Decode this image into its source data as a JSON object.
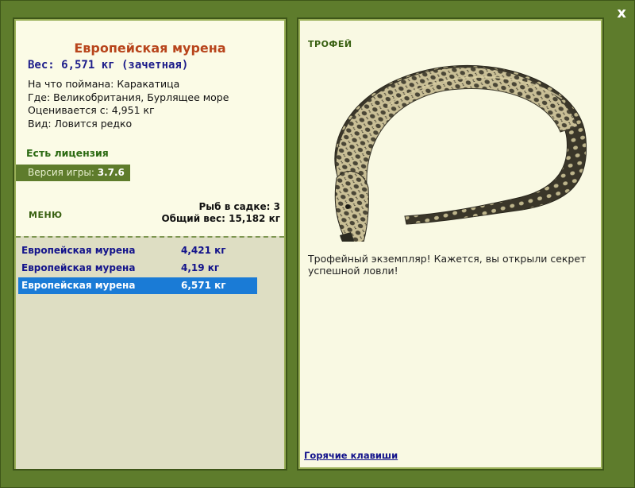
{
  "window": {
    "close_label": "x"
  },
  "fish": {
    "name": "Европейская мурена",
    "weight_line": "Вес: 6,571 кг (зачетная)",
    "info": [
      "На что поймана: Каракатица",
      "Где: Великобритания, Бурлящее море",
      "Оценивается с: 4,951 кг",
      "Вид: Ловится редко"
    ]
  },
  "license": "Есть лицензия",
  "version": {
    "label": "Версия игры:",
    "value": "3.7.6"
  },
  "menu_label": "МЕНЮ",
  "keepnet": {
    "count_line": "Рыб в садке: 3",
    "total_line": "Общий вес: 15,182 кг",
    "items": [
      {
        "name": "Европейская мурена",
        "weight": "4,421 кг",
        "selected": false
      },
      {
        "name": "Европейская мурена",
        "weight": "4,19 кг",
        "selected": false
      },
      {
        "name": "Европейская мурена",
        "weight": "6,571 кг",
        "selected": true
      }
    ]
  },
  "trophy": {
    "label": "ТРОФЕЙ",
    "text": "Трофейный экземпляр! Кажется, вы открыли секрет успешной ловли!"
  },
  "hotkeys_label": "Горячие клавиши",
  "colors": {
    "frame": "#5e7c2c",
    "panel": "#fbfbe6",
    "selected_row": "#1a7bd6",
    "title": "#b8451c"
  }
}
